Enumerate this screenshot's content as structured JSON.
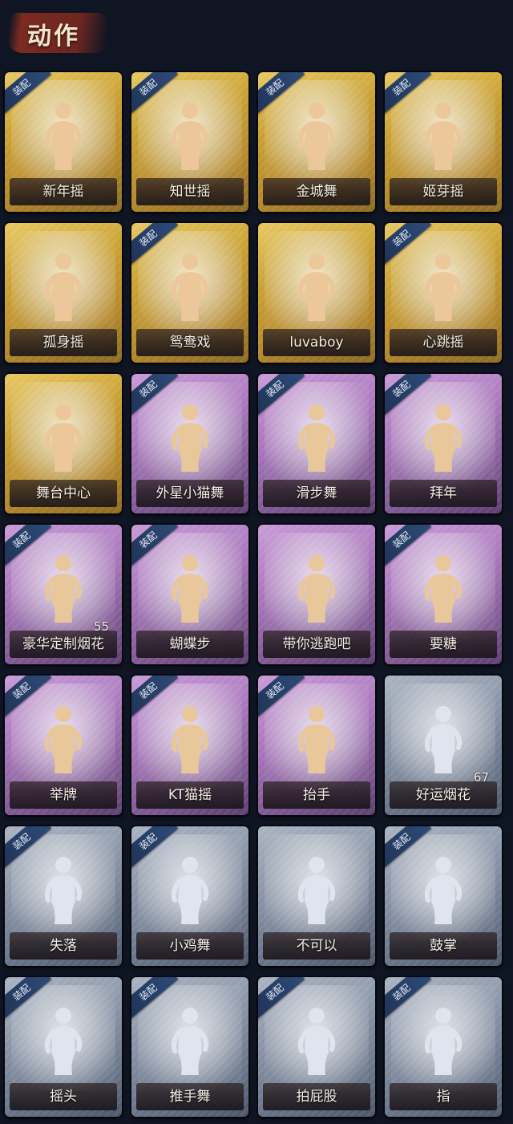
{
  "header": {
    "title": "动作"
  },
  "equip_tag": "装配",
  "cards": [
    {
      "label": "新年摇",
      "tier": "gold",
      "equipped": true
    },
    {
      "label": "知世摇",
      "tier": "gold",
      "equipped": true
    },
    {
      "label": "金城舞",
      "tier": "gold",
      "equipped": true
    },
    {
      "label": "姬芽摇",
      "tier": "gold",
      "equipped": true
    },
    {
      "label": "孤身摇",
      "tier": "gold",
      "equipped": false
    },
    {
      "label": "鸳鸯戏",
      "tier": "gold",
      "equipped": true
    },
    {
      "label": "luvaboy",
      "tier": "gold",
      "equipped": false
    },
    {
      "label": "心跳摇",
      "tier": "gold",
      "equipped": true
    },
    {
      "label": "舞台中心",
      "tier": "gold",
      "equipped": false
    },
    {
      "label": "外星小猫舞",
      "tier": "purple",
      "equipped": true
    },
    {
      "label": "滑步舞",
      "tier": "purple",
      "equipped": true
    },
    {
      "label": "拜年",
      "tier": "purple",
      "equipped": true
    },
    {
      "label": "豪华定制烟花",
      "tier": "purple",
      "equipped": true,
      "count": "55"
    },
    {
      "label": "蝴蝶步",
      "tier": "purple",
      "equipped": true
    },
    {
      "label": "带你逃跑吧",
      "tier": "purple",
      "equipped": false
    },
    {
      "label": "要糖",
      "tier": "purple",
      "equipped": true
    },
    {
      "label": "举牌",
      "tier": "purple",
      "equipped": true
    },
    {
      "label": "KT猫摇",
      "tier": "purple",
      "equipped": true
    },
    {
      "label": "抬手",
      "tier": "purple",
      "equipped": true
    },
    {
      "label": "好运烟花",
      "tier": "gray",
      "equipped": false,
      "count": "67"
    },
    {
      "label": "失落",
      "tier": "gray",
      "equipped": true
    },
    {
      "label": "小鸡舞",
      "tier": "gray",
      "equipped": true
    },
    {
      "label": "不可以",
      "tier": "gray",
      "equipped": false
    },
    {
      "label": "鼓掌",
      "tier": "gray",
      "equipped": true
    },
    {
      "label": "摇头",
      "tier": "gray",
      "equipped": true
    },
    {
      "label": "推手舞",
      "tier": "gray",
      "equipped": true
    },
    {
      "label": "拍屁股",
      "tier": "gray",
      "equipped": true
    },
    {
      "label": "指",
      "tier": "gray",
      "equipped": true
    }
  ],
  "colors": {
    "gold": "#caa132",
    "purple": "#a877bb",
    "gray": "#8893a6",
    "background": "#0f1522",
    "tag": "#2d4a78"
  }
}
